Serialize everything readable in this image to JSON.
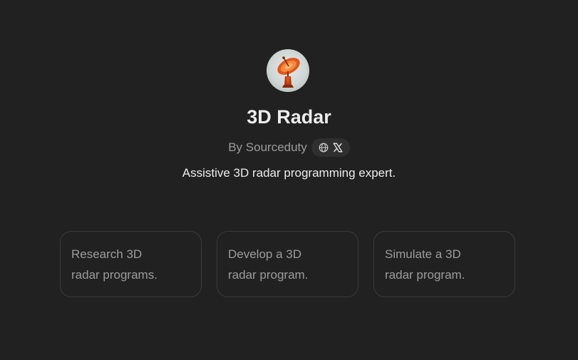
{
  "gpt": {
    "avatar_icon": "radar-dish-avatar-icon",
    "title": "3D Radar",
    "author_prefix": "By Sourceduty",
    "links": [
      {
        "icon": "globe-icon",
        "color": "#cdcdcd"
      },
      {
        "icon": "x-logo-icon",
        "color": "#ececec"
      }
    ],
    "description": "Assistive 3D radar programming expert."
  },
  "conversation_starters": [
    {
      "label": "Research 3D\nradar programs."
    },
    {
      "label": "Develop a 3D\nradar program."
    },
    {
      "label": "Simulate a 3D\nradar program."
    }
  ],
  "colors": {
    "background": "#212121",
    "title_text": "#ececec",
    "muted_text": "#9b9b9b",
    "card_border": "#3a3a3a",
    "pill_background": "#2f2f2f",
    "avatar_accent": "#e2561b"
  }
}
